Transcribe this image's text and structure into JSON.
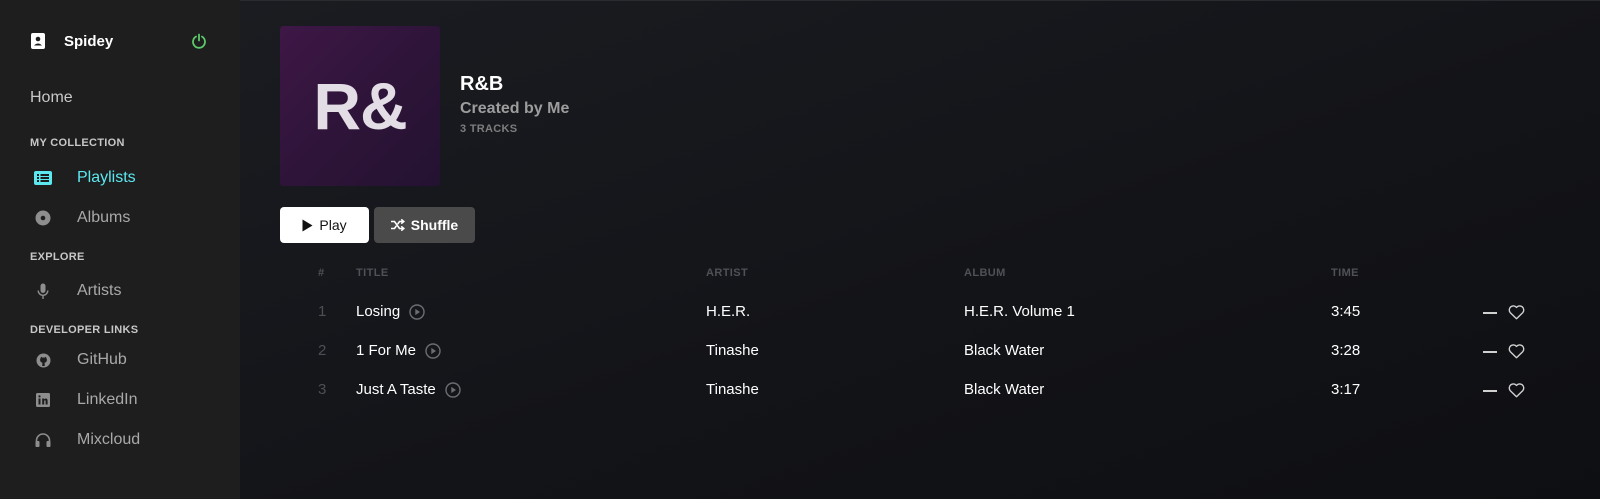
{
  "user": {
    "name": "Spidey",
    "icon": "user-badge-icon",
    "power_icon": "power-icon",
    "power_color": "#5cc96b"
  },
  "nav": {
    "home_label": "Home",
    "sections": {
      "collection": "MY COLLECTION",
      "explore": "EXPLORE",
      "developer": "DEVELOPER LINKS"
    },
    "items": [
      {
        "label": "Playlists",
        "icon": "list-icon",
        "active": true
      },
      {
        "label": "Albums",
        "icon": "disc-icon",
        "active": false
      },
      {
        "label": "Artists",
        "icon": "microphone-icon",
        "active": false
      },
      {
        "label": "GitHub",
        "icon": "github-icon",
        "active": false
      },
      {
        "label": "LinkedIn",
        "icon": "linkedin-icon",
        "active": false
      },
      {
        "label": "Mixcloud",
        "icon": "headphones-icon",
        "active": false
      }
    ],
    "active_color": "#5ce8f0"
  },
  "playlist": {
    "cover_text": "R&",
    "title": "R&B",
    "creator": "Created by Me",
    "track_count": "3 TRACKS"
  },
  "buttons": {
    "play_label": "Play",
    "shuffle_label": "Shuffle"
  },
  "table": {
    "headers": {
      "num": "#",
      "title": "TITLE",
      "artist": "ARTIST",
      "album": "ALBUM",
      "time": "TIME"
    },
    "rows": [
      {
        "num": "1",
        "title": "Losing",
        "artist": "H.E.R.",
        "album": "H.E.R. Volume 1",
        "time": "3:45"
      },
      {
        "num": "2",
        "title": "1 For Me",
        "artist": "Tinashe",
        "album": "Black Water",
        "time": "3:28"
      },
      {
        "num": "3",
        "title": "Just A Taste",
        "artist": "Tinashe",
        "album": "Black Water",
        "time": "3:17"
      }
    ]
  }
}
